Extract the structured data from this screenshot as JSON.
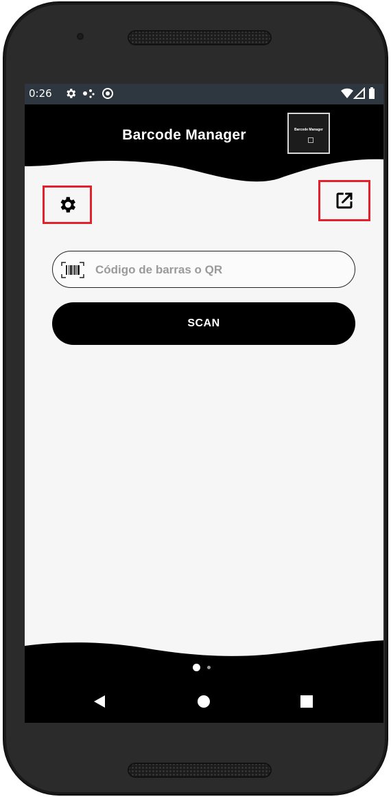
{
  "status_bar": {
    "time": "0:26",
    "icons": [
      "settings-icon",
      "dots-icon",
      "sync-icon",
      "wifi-icon",
      "signal-icon",
      "battery-icon"
    ]
  },
  "header": {
    "title": "Barcode Manager",
    "logo_text": "Barcode Manager"
  },
  "toolbar": {
    "settings_icon": "gear-icon",
    "share_icon": "external-link-icon",
    "highlight_color": "#e3202b"
  },
  "search": {
    "placeholder": "Código de barras o QR",
    "value": "",
    "icon": "barcode-icon"
  },
  "scan_button": {
    "label": "SCAN"
  },
  "pager": {
    "total": 2,
    "active": 1
  },
  "nav_bar": {
    "icons": [
      "back-icon",
      "home-icon",
      "recents-icon"
    ]
  },
  "colors": {
    "status_bar_bg": "#2e3740",
    "header_bg": "#000000",
    "content_bg": "#f6f6f6",
    "button_bg": "#000000",
    "button_text": "#ffffff"
  }
}
